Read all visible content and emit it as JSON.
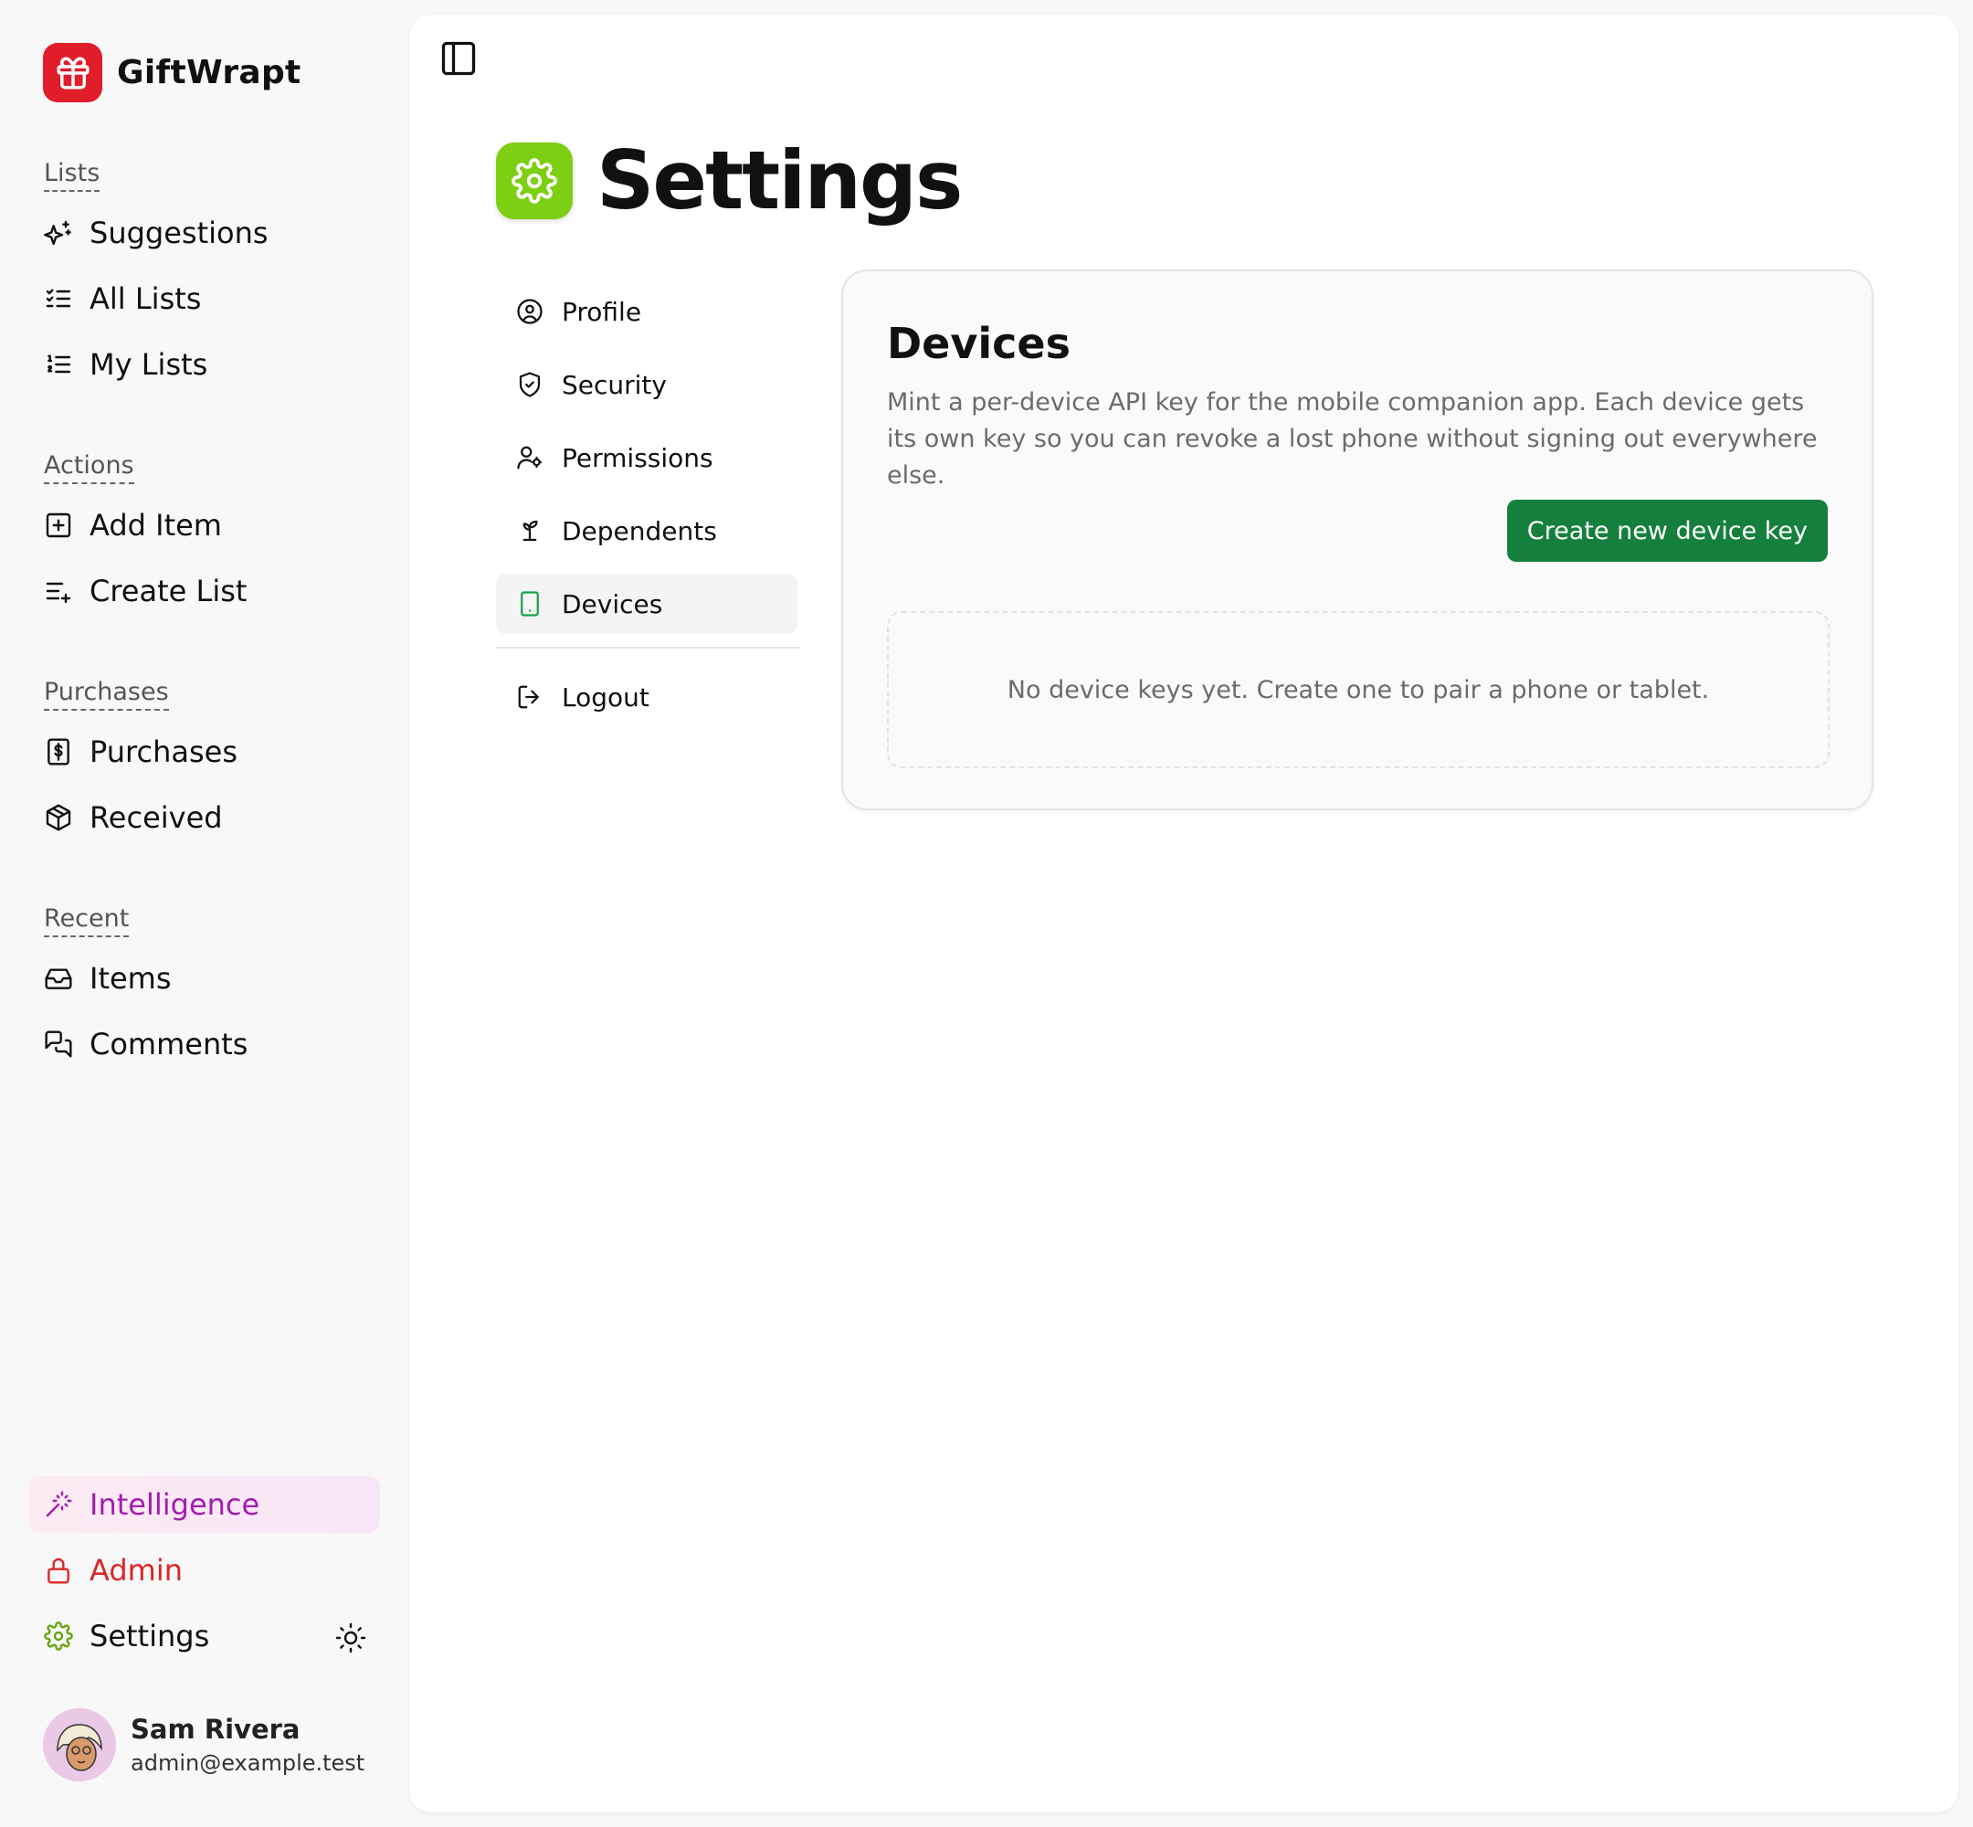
{
  "app": {
    "name": "GiftWrapt"
  },
  "sidebar": {
    "sections": [
      {
        "label": "Lists",
        "items": [
          {
            "label": "Suggestions",
            "icon": "sparkles-icon"
          },
          {
            "label": "All Lists",
            "icon": "list-checks-icon"
          },
          {
            "label": "My Lists",
            "icon": "list-ordered-icon"
          }
        ]
      },
      {
        "label": "Actions",
        "items": [
          {
            "label": "Add Item",
            "icon": "square-plus-icon"
          },
          {
            "label": "Create List",
            "icon": "list-plus-icon"
          }
        ]
      },
      {
        "label": "Purchases",
        "items": [
          {
            "label": "Purchases",
            "icon": "receipt-icon"
          },
          {
            "label": "Received",
            "icon": "package-open-icon"
          }
        ]
      },
      {
        "label": "Recent",
        "items": [
          {
            "label": "Items",
            "icon": "inbox-icon"
          },
          {
            "label": "Comments",
            "icon": "messages-icon"
          }
        ]
      }
    ],
    "bottom": {
      "intelligence": "Intelligence",
      "admin": "Admin",
      "settings": "Settings"
    },
    "user": {
      "name": "Sam Rivera",
      "email": "admin@example.test"
    }
  },
  "page": {
    "title": "Settings"
  },
  "settings_nav": {
    "items": [
      {
        "label": "Profile",
        "icon": "user-circle-icon"
      },
      {
        "label": "Security",
        "icon": "shield-check-icon"
      },
      {
        "label": "Permissions",
        "icon": "user-cog-icon"
      },
      {
        "label": "Dependents",
        "icon": "sprout-icon"
      },
      {
        "label": "Devices",
        "icon": "tablet-icon",
        "active": true
      }
    ],
    "logout": "Logout"
  },
  "devices": {
    "title": "Devices",
    "description": "Mint a per-device API key for the mobile companion app. Each device gets its own key so you can revoke a lost phone without signing out everywhere else.",
    "create_button": "Create new device key",
    "empty_text": "No device keys yet. Create one to pair a phone or tablet."
  },
  "colors": {
    "brand": "#e11d2a",
    "primary_button": "#15803d",
    "settings_icon": "#7ccf12",
    "intelligence": "#a21caf",
    "admin": "#dc2626"
  }
}
